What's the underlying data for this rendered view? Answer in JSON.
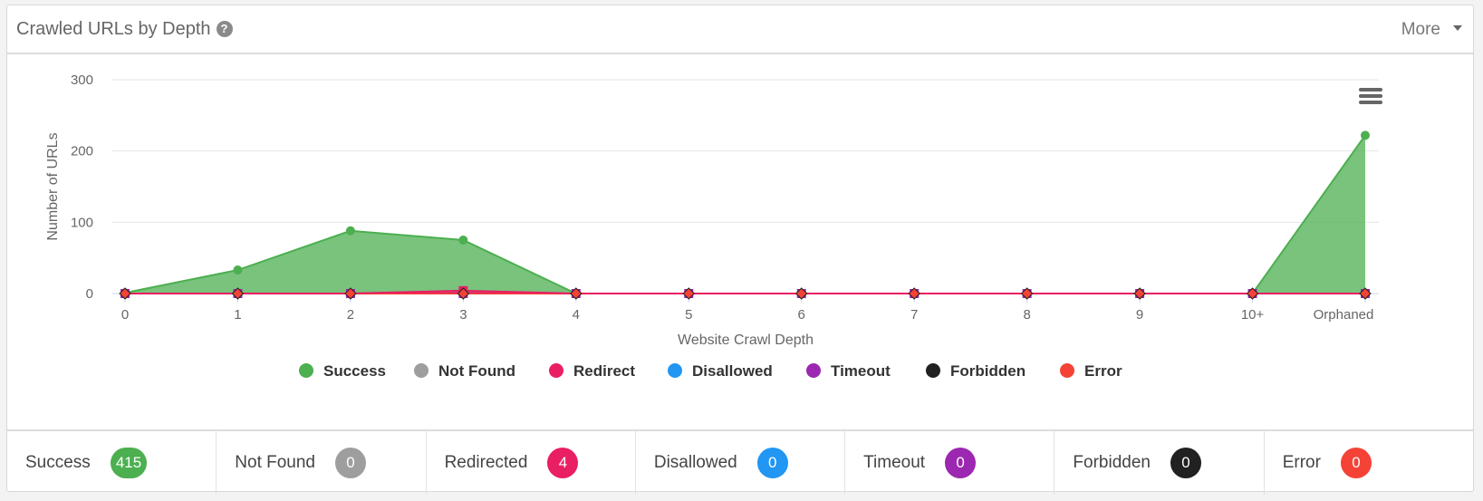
{
  "header": {
    "title": "Crawled URLs by Depth",
    "help_icon": "question-circle-icon",
    "more_label": "More"
  },
  "chart_data": {
    "type": "area",
    "title": "",
    "xlabel": "Website Crawl Depth",
    "ylabel": "Number of URLs",
    "categories": [
      "0",
      "1",
      "2",
      "3",
      "4",
      "5",
      "6",
      "7",
      "8",
      "9",
      "10+",
      "Orphaned"
    ],
    "ylim": [
      0,
      300
    ],
    "yticks": [
      0,
      100,
      200,
      300
    ],
    "grid": true,
    "legend_position": "bottom",
    "series": [
      {
        "name": "Success",
        "color": "#4caf50",
        "values": [
          1,
          33,
          88,
          75,
          0,
          0,
          0,
          0,
          0,
          0,
          0,
          222
        ]
      },
      {
        "name": "Not Found",
        "color": "#9e9e9e",
        "values": [
          0,
          0,
          0,
          0,
          0,
          0,
          0,
          0,
          0,
          0,
          0,
          0
        ]
      },
      {
        "name": "Redirect",
        "color": "#e91e63",
        "values": [
          0,
          0,
          0,
          4,
          0,
          0,
          0,
          0,
          0,
          0,
          0,
          0
        ]
      },
      {
        "name": "Disallowed",
        "color": "#2196f3",
        "values": [
          0,
          0,
          0,
          0,
          0,
          0,
          0,
          0,
          0,
          0,
          0,
          0
        ]
      },
      {
        "name": "Timeout",
        "color": "#9c27b0",
        "values": [
          0,
          0,
          0,
          0,
          0,
          0,
          0,
          0,
          0,
          0,
          0,
          0
        ]
      },
      {
        "name": "Forbidden",
        "color": "#212121",
        "values": [
          0,
          0,
          0,
          0,
          0,
          0,
          0,
          0,
          0,
          0,
          0,
          0
        ]
      },
      {
        "name": "Error",
        "color": "#f44336",
        "values": [
          0,
          0,
          0,
          0,
          0,
          0,
          0,
          0,
          0,
          0,
          0,
          0
        ]
      }
    ]
  },
  "footer": {
    "stats": [
      {
        "label": "Success",
        "value": "415",
        "color": "#4caf50"
      },
      {
        "label": "Not Found",
        "value": "0",
        "color": "#9e9e9e"
      },
      {
        "label": "Redirected",
        "value": "4",
        "color": "#e91e63"
      },
      {
        "label": "Disallowed",
        "value": "0",
        "color": "#2196f3"
      },
      {
        "label": "Timeout",
        "value": "0",
        "color": "#9c27b0"
      },
      {
        "label": "Forbidden",
        "value": "0",
        "color": "#212121"
      },
      {
        "label": "Error",
        "value": "0",
        "color": "#f44336"
      }
    ]
  }
}
